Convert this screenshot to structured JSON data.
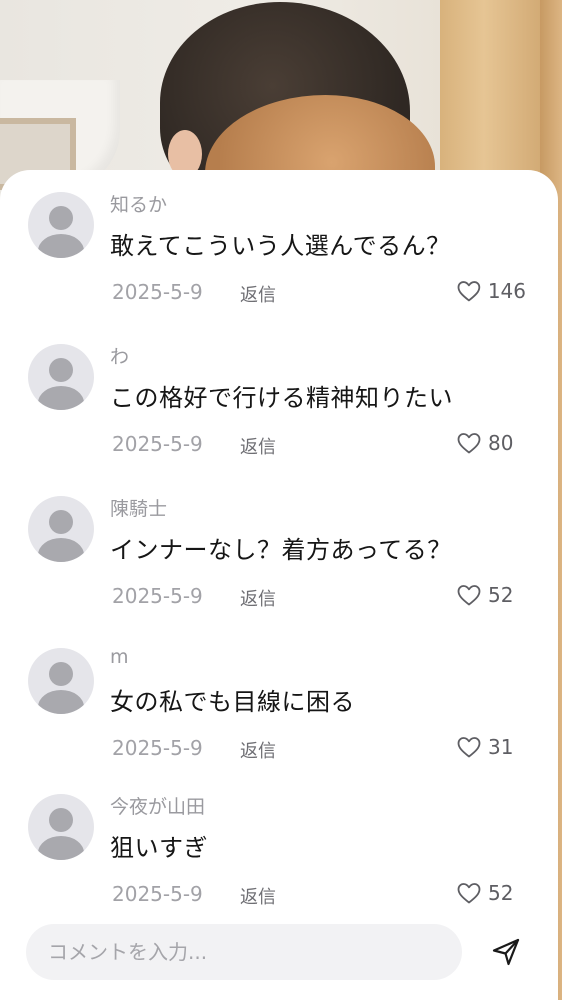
{
  "comments_panel": {
    "comments": [
      {
        "username": "知るか",
        "text": "敢えてこういう人選んでるん？",
        "date": "2025-5-9",
        "reply_label": "返信",
        "likes": "146",
        "avatar_icon": "default-avatar-icon",
        "like_icon": "heart-icon"
      },
      {
        "username": "わ",
        "text": "この格好で行ける精神知りたい",
        "date": "2025-5-9",
        "reply_label": "返信",
        "likes": "80",
        "avatar_icon": "default-avatar-icon",
        "like_icon": "heart-icon"
      },
      {
        "username": "陳騎士",
        "text": "インナーなし？着方あってる？",
        "date": "2025-5-9",
        "reply_label": "返信",
        "likes": "52",
        "avatar_icon": "default-avatar-icon",
        "like_icon": "heart-icon"
      },
      {
        "username": "m",
        "text": "女の私でも目線に困る",
        "date": "2025-5-9",
        "reply_label": "返信",
        "likes": "31",
        "avatar_icon": "default-avatar-icon",
        "like_icon": "heart-icon"
      },
      {
        "username": "今夜が山田",
        "text": "狙いすぎ",
        "date": "2025-5-9",
        "reply_label": "返信",
        "likes": "52",
        "avatar_icon": "default-avatar-icon",
        "like_icon": "heart-icon"
      }
    ]
  },
  "input": {
    "placeholder": "コメントを入力...",
    "value": "",
    "send_icon": "send-icon"
  },
  "colors": {
    "text_primary": "#161616",
    "text_secondary": "#9a9a9f",
    "avatar_bg": "#e5e5ea",
    "avatar_fg": "#a9a9ae",
    "input_bg": "#f2f2f4"
  }
}
